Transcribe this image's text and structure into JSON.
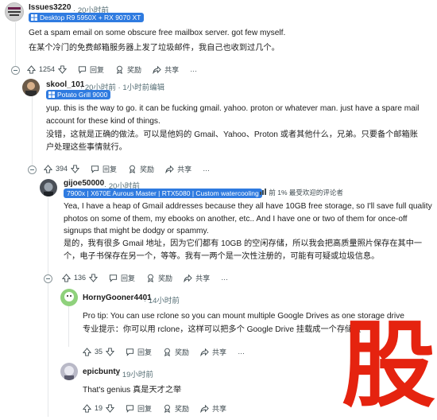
{
  "comments": [
    {
      "username": "Issues3220",
      "time": "20小时前",
      "flair": "Desktop R9 5950X + RX 9070 XT",
      "body_en": "Get a spam email on some obscure free mailbox server. got few myself.",
      "body_zh": "在某个冷门的免费邮箱服务器上发了垃圾邮件，我自己也收到过几个。",
      "score": "1254",
      "reply": "回复",
      "award": "奖励",
      "share": "共享",
      "more": "…"
    },
    {
      "username": "skool_101",
      "time": "20小时前",
      "edited": "1小时前编辑",
      "flair": "Potato Grill 9000",
      "body_en_1": "yup. this is the way to go. it can be fucking gmail. yahoo. proton or whatever man. just have a spare mail",
      "body_en_2": "account for these kind of things.",
      "body_zh_1": "没错，这就是正确的做法。可以是他妈的 Gmail、Yahoo、Proton 或者其他什么，兄弟。只要备个邮箱账",
      "body_zh_2": "户处理这些事情就行。",
      "score": "394",
      "reply": "回复",
      "award": "奖励",
      "share": "共享",
      "more": "…"
    },
    {
      "username": "gijoe50000",
      "time": "20小时前",
      "flair": "7900x | X670E Aurous Master | RTX5080 | Custom watercooling",
      "badge": "前 1% 最受欢迎的评论者",
      "body_en_1": "Yea, I have a heap of Gmail addresses because they all have 10GB free storage, so I'll save full quality",
      "body_en_2": "photos on some of them, my ebooks on another, etc.. And I have one or two of them for once-off",
      "body_en_3": "signups that might be dodgy or spammy.",
      "body_zh_1": "是的，我有很多 Gmail 地址，因为它们都有 10GB 的空闲存储，所以我会把高质量照片保存在其中一",
      "body_zh_2": "个，电子书保存在另一个，等等。我有一两个是一次性注册的，可能有可疑或垃圾信息。",
      "score": "136",
      "reply": "回复",
      "award": "奖励",
      "share": "共享",
      "more": "…"
    },
    {
      "username": "HornyGooner4401",
      "time": "14小时前",
      "body_en": "Pro tip: You can use rclone so you can mount multiple Google Drives as one storage drive",
      "body_zh": "专业提示：你可以用 rclone，这样可以把多个 Google Drive 挂载成一个存储盘",
      "score": "35",
      "reply": "回复",
      "award": "奖励",
      "share": "共享",
      "more": "…"
    },
    {
      "username": "epicbunty",
      "time": "19小时前",
      "body": "That's genius   真是天才之举",
      "score": "19",
      "reply": "回复",
      "award": "奖励",
      "share": "共享"
    }
  ],
  "watermark": "股",
  "colors": {
    "flair": "#2f7be0",
    "watermark": "#e5230f",
    "meta": "#576f76"
  }
}
